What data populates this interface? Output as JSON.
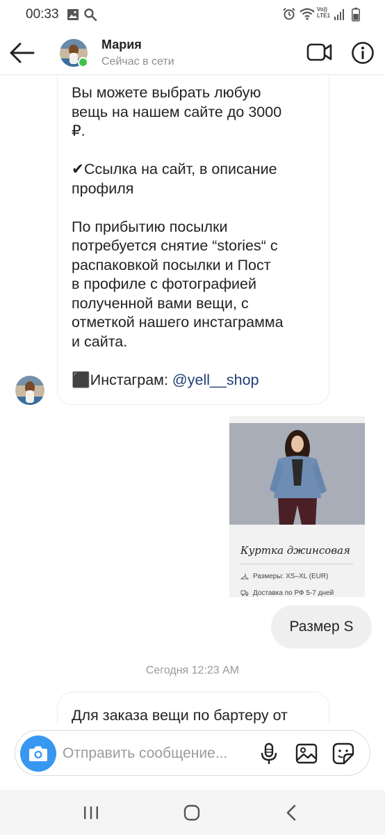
{
  "status_bar": {
    "time": "00:33",
    "left_icons": [
      "image-icon",
      "search-icon"
    ],
    "right_icons": [
      "alarm-icon",
      "wifi-icon",
      "volte-icon",
      "signal-icon",
      "battery-icon"
    ],
    "volte_text": "Vo)) LTE1"
  },
  "header": {
    "contact_name": "Мария",
    "contact_status": "Сейчас в сети",
    "icons": [
      "back-arrow-icon",
      "video-call-icon",
      "info-icon"
    ]
  },
  "messages": {
    "bubble_1_lines": [
      "Вы можете выбрать любую",
      "вещь на нашем сайте до 3000",
      "₽.",
      "",
      "✔Ссылка на сайт, в описание",
      "профиля",
      "",
      "По прибытию посылки",
      "потребуется снятие “stories“ с",
      "распаковкой посылки и Пост",
      "в профиле с фотографией",
      "полученной вами вещи, с",
      "отметкой нашего инстаграмма",
      "и сайта.",
      ""
    ],
    "instagram_prefix": "⬛Инстаграм: ",
    "instagram_handle": "@yell__shop",
    "product_card": {
      "title": "Куртка джинсовая",
      "sizes": "Размеры: XS–XL (EUR)",
      "delivery": "Доставка по РФ 5-7 дней"
    },
    "outgoing_text": "Размер S",
    "timestamp": "Сегодня 12:23 AM",
    "bubble_2_text": "Для заказа вещи по бартеру от"
  },
  "composer": {
    "placeholder": "Отправить сообщение...",
    "icons": [
      "camera-icon",
      "microphone-icon",
      "gallery-icon",
      "sticker-icon"
    ],
    "accent_color": "#3897f0"
  },
  "nav_bar": {
    "icons": [
      "recent-apps-icon",
      "home-icon",
      "back-nav-icon"
    ]
  },
  "colors": {
    "online": "#44c24a",
    "mention": "#1d3f73",
    "outgoing_bubble": "#efefef"
  }
}
